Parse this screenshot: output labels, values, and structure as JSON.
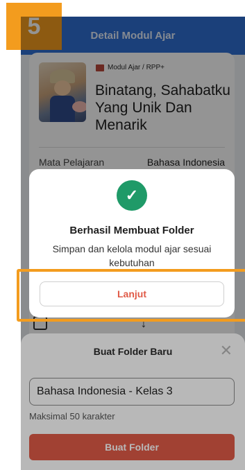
{
  "step_badge": "5",
  "header": {
    "title": "Detail Modul Ajar"
  },
  "module": {
    "breadcrumb": "Modul Ajar / RPP+",
    "title": "Binatang, Sahabatku Yang Unik Dan Menarik",
    "subject_label": "Mata Pelajaran",
    "subject_value": "Bahasa Indonesia"
  },
  "dialog": {
    "title": "Berhasil Membuat Folder",
    "message": "Simpan dan kelola modul ajar sesuai kebutuhan",
    "continue_label": "Lanjut"
  },
  "sheet": {
    "title": "Buat Folder Baru",
    "folder_name_value": "Bahasa Indonesia - Kelas 3",
    "helper": "Maksimal 50 karakter",
    "create_label": "Buat Folder"
  },
  "colors": {
    "brand_blue": "#2f6fd2",
    "accent_red": "#e05a47",
    "success_green": "#1f9a68",
    "highlight_orange": "#f39c1e"
  },
  "icons": [
    "book-icon",
    "check-icon",
    "close-icon",
    "thumbs-up-icon",
    "download-icon"
  ]
}
